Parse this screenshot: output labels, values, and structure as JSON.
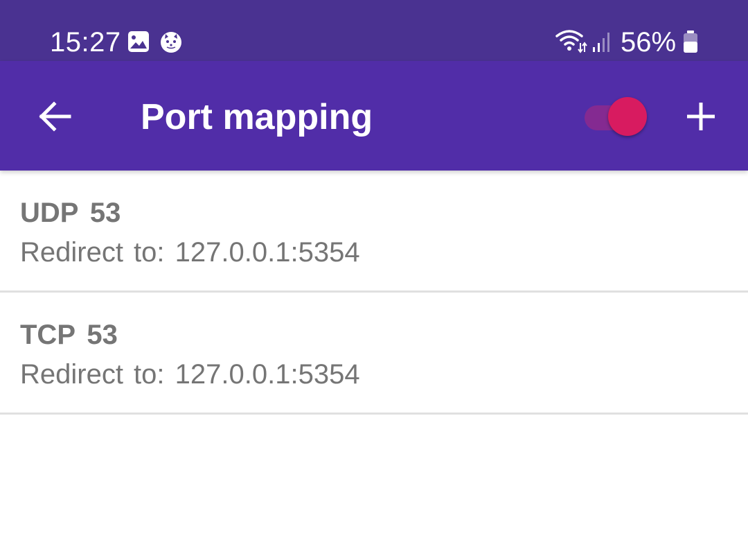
{
  "status_bar": {
    "time": "15:27",
    "icons": [
      "image-icon",
      "cat-face-icon"
    ],
    "wifi_icon": "wifi-icon",
    "signal_icon": "signal-icon",
    "battery_percent": "56%",
    "battery_icon": "battery-icon"
  },
  "app_bar": {
    "title": "Port mapping",
    "back_icon": "arrow-left-icon",
    "add_icon": "plus-icon",
    "toggle_on": true,
    "colors": {
      "status_bar": "#4A3291",
      "app_bar": "#512DA8",
      "toggle_thumb": "#D81B60",
      "toggle_track": "#8A2A8E"
    }
  },
  "mappings": [
    {
      "protocol": "UDP",
      "port": "53",
      "title": "UDP  53",
      "subtitle": "Redirect to:  127.0.0.1:5354"
    },
    {
      "protocol": "TCP",
      "port": "53",
      "title": "TCP  53",
      "subtitle": "Redirect to:  127.0.0.1:5354"
    }
  ]
}
